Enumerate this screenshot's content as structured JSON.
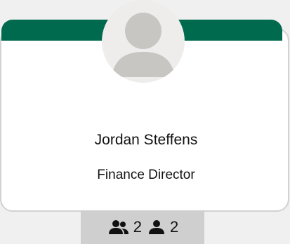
{
  "person": {
    "name": "Jordan Steffens",
    "title": "Finance Director"
  },
  "stats": {
    "team_count": "2",
    "direct_count": "2"
  },
  "icons": {
    "avatar": "user-avatar-icon",
    "team": "people-group-icon",
    "direct": "person-icon"
  },
  "colors": {
    "banner": "#006a4e",
    "avatar_bg": "#efedeb",
    "avatar_fg": "#c8c6c3",
    "footer_bg": "#cfcfcf"
  }
}
